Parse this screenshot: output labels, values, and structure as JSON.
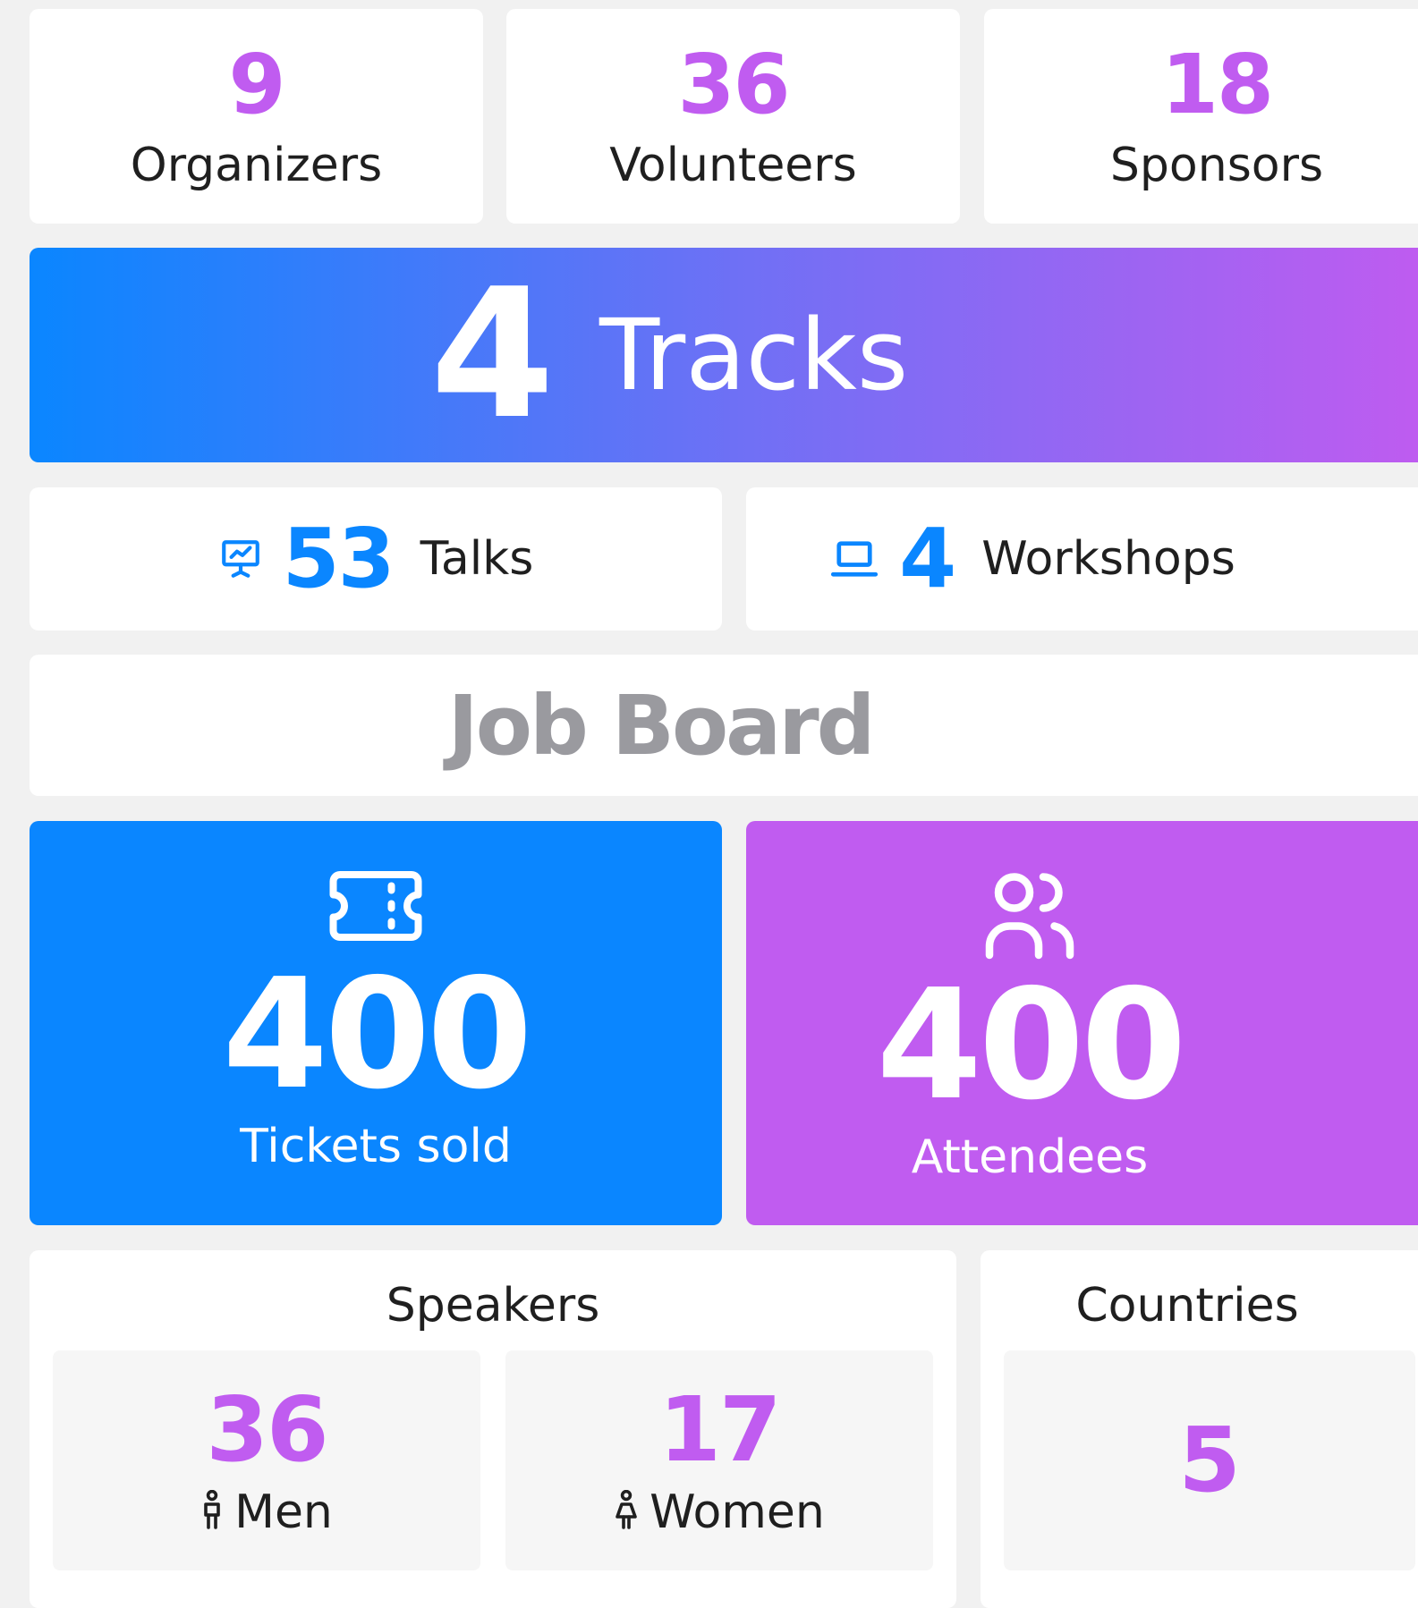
{
  "colors": {
    "purple": "#c05cf0",
    "blue": "#0a86ff",
    "gray": "#9a9a9f",
    "background": "#f1f1f1"
  },
  "stats": [
    {
      "value": "9",
      "label": "Organizers"
    },
    {
      "value": "36",
      "label": "Volunteers"
    },
    {
      "value": "18",
      "label": "Sponsors"
    }
  ],
  "tracks": {
    "value": "4",
    "label": "Tracks"
  },
  "talks": {
    "icon": "presentation-icon",
    "value": "53",
    "label": "Talks"
  },
  "workshops": {
    "icon": "laptop-icon",
    "value": "4",
    "label": "Workshops"
  },
  "job_board": {
    "label": "Job Board"
  },
  "tickets": {
    "icon": "ticket-icon",
    "value": "400",
    "label": "Tickets sold"
  },
  "attendees": {
    "icon": "users-icon",
    "value": "400",
    "label": "Attendees"
  },
  "speakers": {
    "title": "Speakers",
    "men": {
      "icon": "male-icon",
      "value": "36",
      "label": "Men"
    },
    "women": {
      "icon": "female-icon",
      "value": "17",
      "label": "Women"
    }
  },
  "countries": {
    "title": "Countries",
    "value": "5"
  }
}
